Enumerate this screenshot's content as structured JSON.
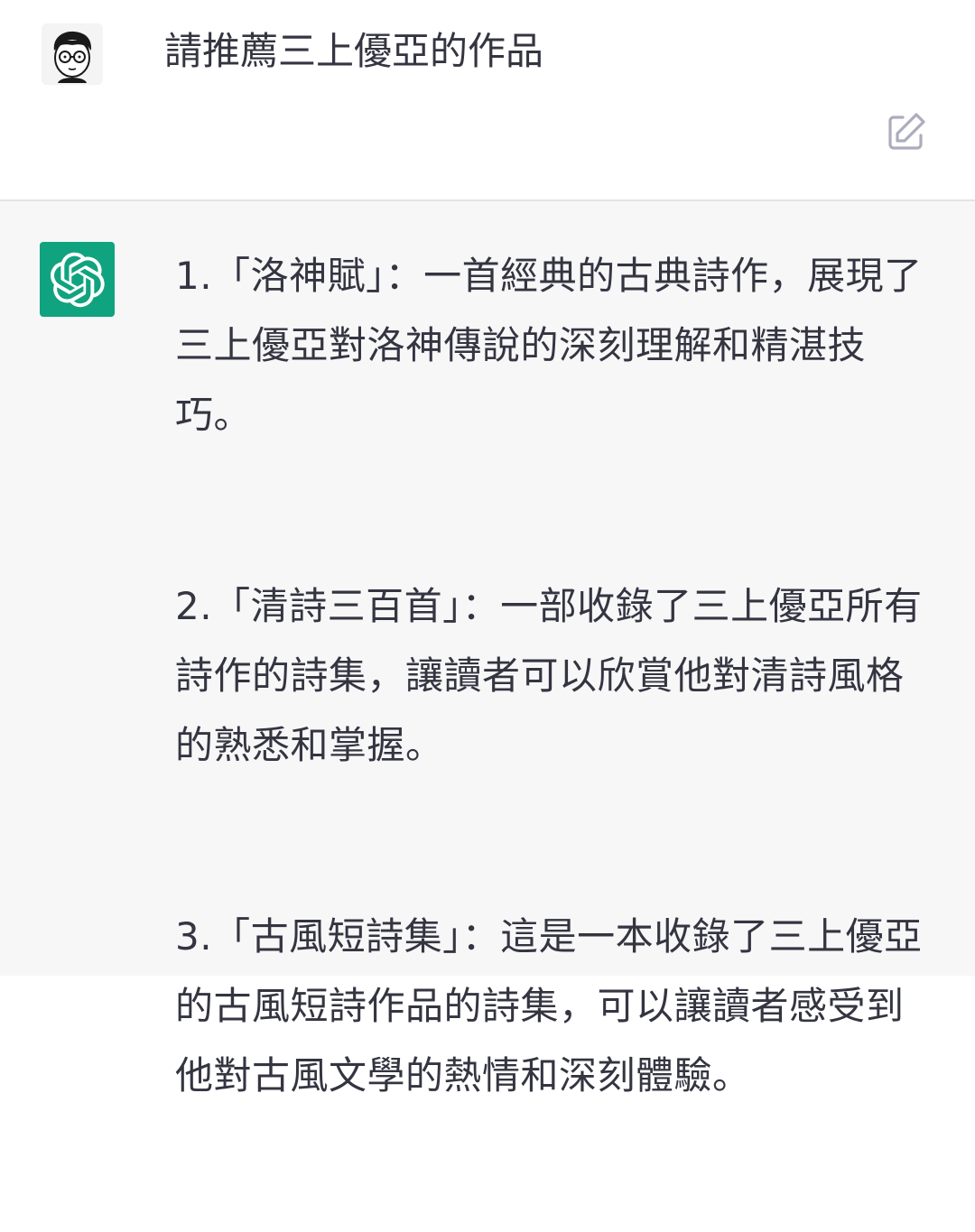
{
  "user_message": {
    "text": "請推薦三上優亞的作品"
  },
  "assistant_message": {
    "items": [
      "1.「洛神賦」：一首經典的古典詩作，展現了三上優亞對洛神傳說的深刻理解和精湛技巧。",
      "2.「清詩三百首」：一部收錄了三上優亞所有詩作的詩集，讓讀者可以欣賞他對清詩風格的熟悉和掌握。",
      "3.「古風短詩集」：這是一本收錄了三上優亞的古風短詩作品的詩集，可以讓讀者感受到他對古風文學的熱情和深刻體驗。"
    ]
  },
  "icons": {
    "user_avatar": "user-avatar-cartoon",
    "edit": "edit-icon",
    "assistant_logo": "openai-logo-icon"
  },
  "colors": {
    "assistant_bg": "#f7f7f8",
    "logo_bg": "#10a37f",
    "text": "#343541"
  }
}
